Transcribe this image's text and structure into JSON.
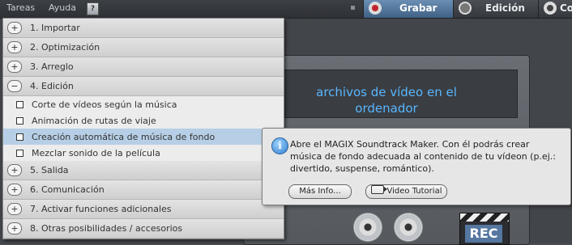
{
  "menubar": {
    "tareas": "Tareas",
    "ayuda": "Ayuda",
    "help_badge": "?"
  },
  "modes": [
    {
      "label": "Grabar",
      "icon": "record-icon",
      "active": true
    },
    {
      "label": "Edición",
      "icon": "film-reel-icon",
      "active": false
    },
    {
      "label": "Co",
      "icon": "disc-icon",
      "active": false
    }
  ],
  "workspace": {
    "import_title": "archivos de vídeo en el ordenador",
    "rec_label": "REC"
  },
  "dropdown": {
    "categories": [
      {
        "sign": "+",
        "label": "1. Importar"
      },
      {
        "sign": "+",
        "label": "2. Optimización"
      },
      {
        "sign": "+",
        "label": "3. Arreglo"
      },
      {
        "sign": "−",
        "label": "4. Edición"
      },
      {
        "sign": "+",
        "label": "5. Salida"
      },
      {
        "sign": "+",
        "label": "6. Comunicación"
      },
      {
        "sign": "+",
        "label": "7. Activar funciones adicionales"
      },
      {
        "sign": "+",
        "label": "8. Otras posibilidades / accesorios"
      }
    ],
    "subitems": [
      {
        "label": "Corte de vídeos según la música"
      },
      {
        "label": "Animación de rutas de viaje"
      },
      {
        "label": "Creación  automática de música de fondo",
        "highlighted": true
      },
      {
        "label": "Mezclar sonido de la película"
      }
    ]
  },
  "tooltip": {
    "text": "Abre el MAGIX Soundtrack Maker. Con él podrás crear música de fondo adecuada al contenido de tu vídeon (p.ej.: divertido, suspense, romántico).",
    "more_info": "Más Info...",
    "video_tutorial": "Video Tutorial"
  },
  "colors": {
    "accent_blue": "#58b7ff",
    "highlight_row": "#b7cfe6",
    "rec_red": "#c0242a"
  }
}
